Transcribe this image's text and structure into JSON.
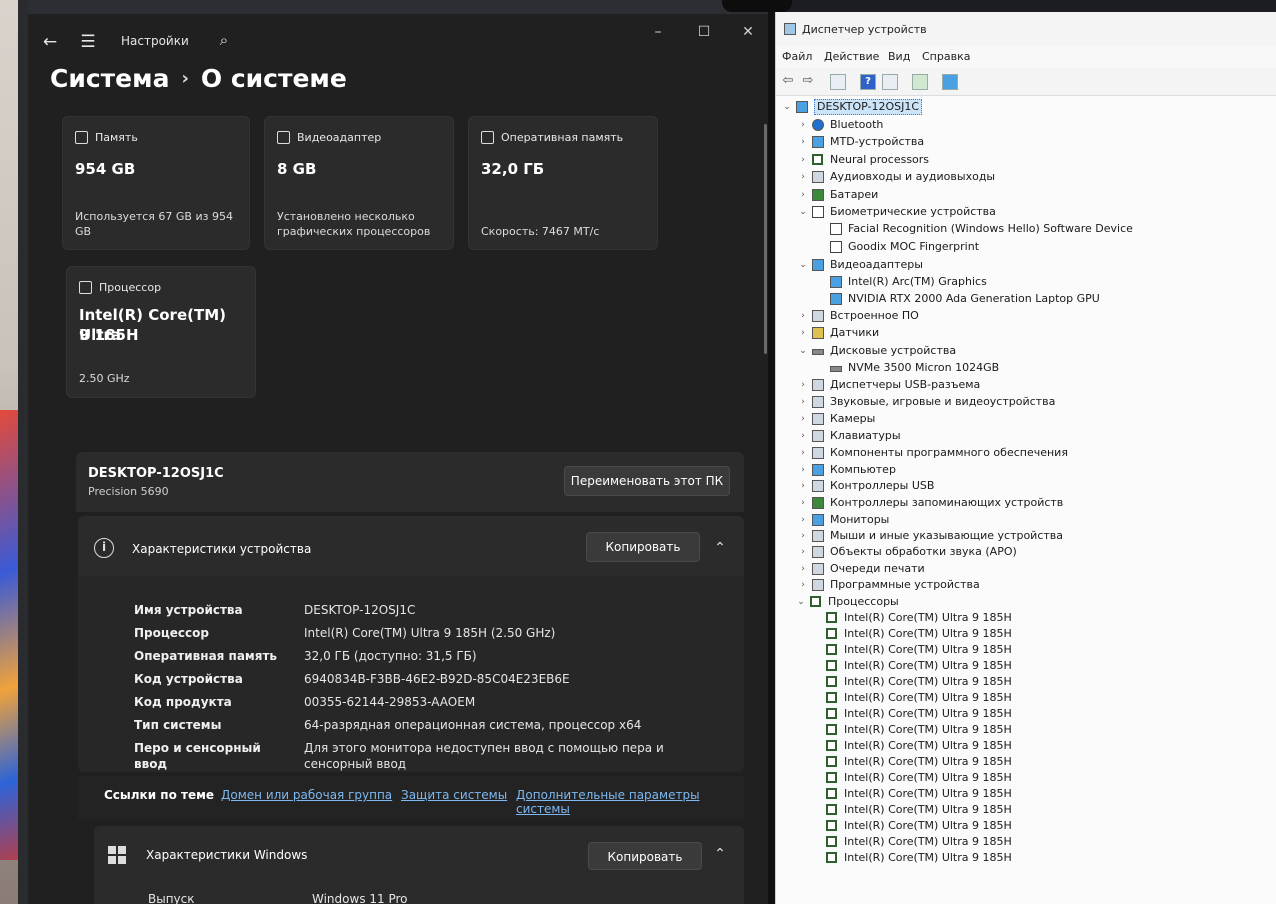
{
  "settings": {
    "app_title": "Настройки",
    "breadcrumb_parent": "Система",
    "breadcrumb_current": "О системе",
    "cards": {
      "storage": {
        "label": "Память",
        "value": "954 GB",
        "sub": "Используется 67 GB из 954 GB"
      },
      "gpu": {
        "label": "Видеоадаптер",
        "value": "8 GB",
        "sub_line1": "Установлено несколько",
        "sub_line2": "графических процессоров"
      },
      "ram": {
        "label": "Оперативная память",
        "value": "32,0 ГБ",
        "sub": "Скорость: 7467 МТ/с"
      },
      "cpu": {
        "label": "Процессор",
        "value_line1": "Intel(R) Core(TM) Ultra",
        "value_line2": "9 185H",
        "sub": "2.50 GHz"
      }
    },
    "device_name": "DESKTOP-12OSJ1C",
    "device_model": "Precision 5690",
    "rename_button": "Переименовать этот ПК",
    "specs": {
      "title": "Характеристики устройства",
      "copy_button": "Копировать",
      "rows": [
        {
          "key": "Имя устройства",
          "value": "DESKTOP-12OSJ1C"
        },
        {
          "key": "Процессор",
          "value": "Intel(R) Core(TM) Ultra 9 185H (2.50 GHz)"
        },
        {
          "key": "Оперативная память",
          "value": "32,0 ГБ (доступно: 31,5 ГБ)"
        },
        {
          "key": "Код устройства",
          "value": "6940834B-F3BB-46E2-B92D-85C04E23EB6E"
        },
        {
          "key": "Код продукта",
          "value": "00355-62144-29853-AAOEM"
        },
        {
          "key": "Тип системы",
          "value": "64-разрядная операционная система, процессор x64"
        },
        {
          "key": "Перо и сенсорный ввод",
          "value_line1": "Для этого монитора недоступен ввод с помощью пера и",
          "value_line2": "сенсорный ввод"
        }
      ]
    },
    "related_links": {
      "label": "Ссылки по теме",
      "links": [
        "Домен или рабочая группа",
        "Защита системы",
        "Дополнительные параметры системы"
      ]
    },
    "windows_specs": {
      "title": "Характеристики Windows",
      "copy_button": "Копировать",
      "row_key": "Выпуск",
      "row_value": "Windows 11 Pro"
    }
  },
  "devmgr": {
    "title": "Диспетчер устройств",
    "menu": [
      "Файл",
      "Действие",
      "Вид",
      "Справка"
    ],
    "root": "DESKTOP-12OSJ1C",
    "categories": [
      {
        "label": "Bluetooth",
        "expanded": false
      },
      {
        "label": "MTD-устройства",
        "expanded": false
      },
      {
        "label": "Neural processors",
        "expanded": false
      },
      {
        "label": "Аудиовходы и аудиовыходы",
        "expanded": false
      },
      {
        "label": "Батареи",
        "expanded": false
      },
      {
        "label": "Биометрические устройства",
        "expanded": true,
        "children": [
          "Facial Recognition (Windows Hello) Software Device",
          "Goodix MOC Fingerprint"
        ]
      },
      {
        "label": "Видеоадаптеры",
        "expanded": true,
        "children": [
          "Intel(R) Arc(TM) Graphics",
          "NVIDIA RTX 2000 Ada Generation Laptop GPU"
        ]
      },
      {
        "label": "Встроенное ПО",
        "expanded": false
      },
      {
        "label": "Датчики",
        "expanded": false
      },
      {
        "label": "Дисковые устройства",
        "expanded": true,
        "children": [
          "NVMe 3500 Micron 1024GB"
        ]
      },
      {
        "label": "Диспетчеры USB-разъема",
        "expanded": false
      },
      {
        "label": "Звуковые, игровые и видеоустройства",
        "expanded": false
      },
      {
        "label": "Камеры",
        "expanded": false
      },
      {
        "label": "Клавиатуры",
        "expanded": false
      },
      {
        "label": "Компоненты программного обеспечения",
        "expanded": false
      },
      {
        "label": "Компьютер",
        "expanded": false
      },
      {
        "label": "Контроллеры USB",
        "expanded": false
      },
      {
        "label": "Контроллеры запоминающих устройств",
        "expanded": false
      },
      {
        "label": "Мониторы",
        "expanded": false
      },
      {
        "label": "Мыши и иные указывающие устройства",
        "expanded": false
      },
      {
        "label": "Объекты обработки звука (APO)",
        "expanded": false
      },
      {
        "label": "Очереди печати",
        "expanded": false
      },
      {
        "label": "Программные устройства",
        "expanded": false
      },
      {
        "label": "Процессоры",
        "expanded": true,
        "children": [
          "Intel(R) Core(TM) Ultra 9 185H",
          "Intel(R) Core(TM) Ultra 9 185H",
          "Intel(R) Core(TM) Ultra 9 185H",
          "Intel(R) Core(TM) Ultra 9 185H",
          "Intel(R) Core(TM) Ultra 9 185H",
          "Intel(R) Core(TM) Ultra 9 185H",
          "Intel(R) Core(TM) Ultra 9 185H",
          "Intel(R) Core(TM) Ultra 9 185H",
          "Intel(R) Core(TM) Ultra 9 185H",
          "Intel(R) Core(TM) Ultra 9 185H",
          "Intel(R) Core(TM) Ultra 9 185H",
          "Intel(R) Core(TM) Ultra 9 185H",
          "Intel(R) Core(TM) Ultra 9 185H",
          "Intel(R) Core(TM) Ultra 9 185H",
          "Intel(R) Core(TM) Ultra 9 185H",
          "Intel(R) Core(TM) Ultra 9 185H"
        ]
      }
    ]
  }
}
